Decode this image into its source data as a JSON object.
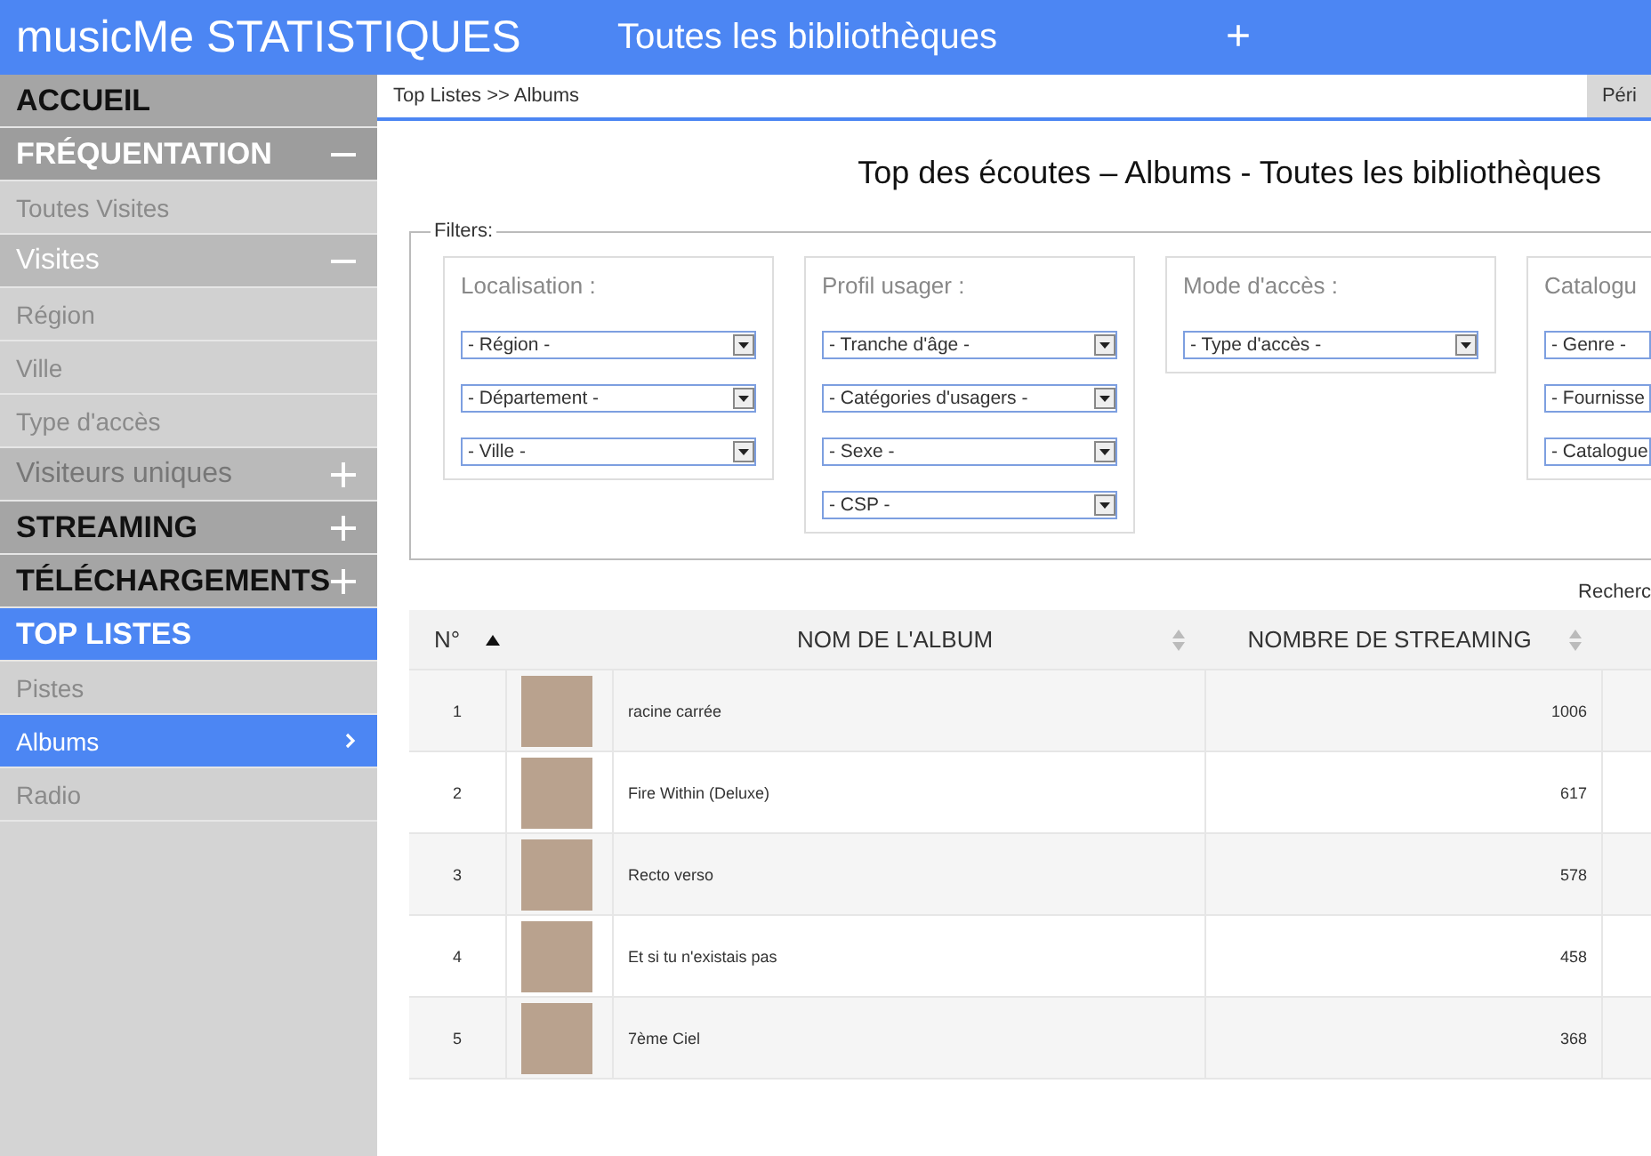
{
  "header": {
    "title": "musicMe STATISTIQUES",
    "library": "Toutes les bibliothèques",
    "add": "+"
  },
  "sidebar": {
    "items": [
      {
        "kind": "section",
        "label": "ACCUEIL",
        "selected": false
      },
      {
        "kind": "section",
        "label": "FRÉQUENTATION",
        "expanded": true,
        "selected": false
      },
      {
        "kind": "link",
        "label": "Toutes Visites",
        "selected": false
      },
      {
        "kind": "group",
        "label": "Visites",
        "expanded": true,
        "selected": false
      },
      {
        "kind": "link",
        "label": "Région",
        "selected": false
      },
      {
        "kind": "link",
        "label": "Ville",
        "selected": false
      },
      {
        "kind": "link",
        "label": "Type d'accès",
        "selected": false
      },
      {
        "kind": "group",
        "label": "Visiteurs uniques",
        "expanded": false,
        "selected": false
      },
      {
        "kind": "section",
        "label": "STREAMING",
        "expanded": false,
        "selected": false
      },
      {
        "kind": "section",
        "label": "TÉLÉCHARGEMENTS",
        "expanded": false,
        "selected": false
      },
      {
        "kind": "section",
        "label": "TOP LISTES",
        "selected": true
      },
      {
        "kind": "link",
        "label": "Pistes",
        "selected": false
      },
      {
        "kind": "link",
        "label": "Albums",
        "selected": true
      },
      {
        "kind": "link",
        "label": "Radio",
        "selected": false
      }
    ]
  },
  "breadcrumb": "Top Listes >> Albums",
  "period_button": "Péri",
  "heading": "Top des écoutes – Albums - Toutes les bibliothèques",
  "filters": {
    "legend": "Filters:",
    "groups": [
      {
        "title": "Localisation :",
        "selects": [
          "- Région -",
          "- Département -",
          "- Ville -"
        ]
      },
      {
        "title": "Profil usager :",
        "selects": [
          "- Tranche d'âge -",
          "- Catégories d'usagers -",
          "- Sexe -",
          "- CSP -"
        ]
      },
      {
        "title": "Mode d'accès :",
        "selects": [
          "- Type d'accès -"
        ]
      },
      {
        "title": "Catalogu",
        "selects": [
          "- Genre -",
          "- Fournisse",
          "- Catalogue"
        ]
      }
    ]
  },
  "search_label": "Recherc",
  "table": {
    "columns": [
      {
        "label": "N°",
        "sorted": true
      },
      {
        "label": "NOM DE L'ALBUM",
        "sorted": false
      },
      {
        "label": "NOMBRE DE STREAMING",
        "sorted": false
      }
    ],
    "rows": [
      {
        "rank": "1",
        "album": "racine carrée",
        "streams": "1006"
      },
      {
        "rank": "2",
        "album": "Fire Within (Deluxe)",
        "streams": "617"
      },
      {
        "rank": "3",
        "album": "Recto verso",
        "streams": "578"
      },
      {
        "rank": "4",
        "album": "Et si tu n'existais pas",
        "streams": "458"
      },
      {
        "rank": "5",
        "album": "7ème Ciel",
        "streams": "368"
      }
    ]
  }
}
